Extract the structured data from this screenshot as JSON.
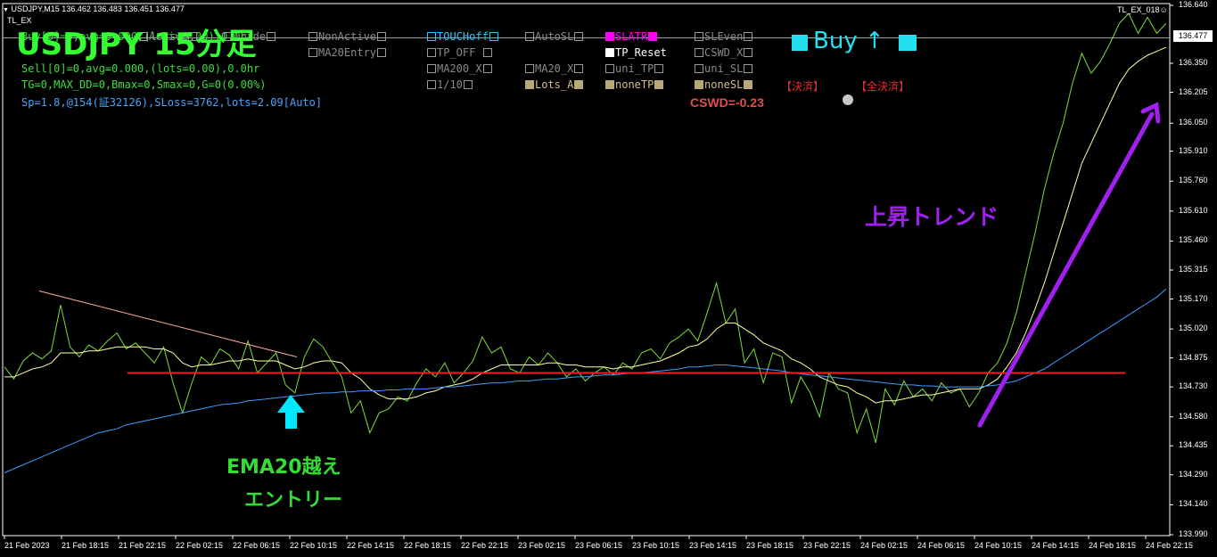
{
  "header": {
    "symbol_line": "USDJPY,M15  136.462 136.483 136.451 136.477",
    "indicator_name": "TL_EX",
    "right_label": "TL_EX_018☺"
  },
  "title_overlay": "USDJPY 15分足",
  "info_lines": [
    "Buy[0]=0,avg=0.000,(lots=0.00),0.0hr",
    "Sell[0]=0,avg=0.000,(lots=0.00),0.0hr",
    "TG=0,MAX_DD=0,Bmax=0,Smax=0,G=0(0.00%)",
    "Sp=1.8,@154(証32126),SLoss=3762,lots=2.09[Auto]"
  ],
  "buttons_row1": {
    "a": "Active",
    "b": "Trade",
    "c": "NonActive"
  },
  "buttons": {
    "ma20entry": "MA20Entry",
    "touchoff": "TOUCHoff",
    "tpoff": "TP_OFF",
    "ma200x": "MA200_X",
    "one_ten": "1/10",
    "autosl": "AutoSL",
    "ma20x": "MA20_X",
    "lots_a": "Lots_A",
    "slatr": "SLATR",
    "tp_reset": "TP_Reset",
    "uni_tp": "uni_TP",
    "nonetp": "noneTP",
    "sleven": "SLEven",
    "cswd_x": "CSWD_X",
    "uni_sl": "uni_SL",
    "nonesl": "noneSL",
    "kessai": "【決済】",
    "zen_kessai": "【全決済】"
  },
  "cswd": "CSWD=-0.23",
  "buy_label": "Buy ↑",
  "annotations": {
    "entry_line1": "EMA20越え",
    "entry_line2": "エントリー",
    "trend": "上昇トレンド"
  },
  "colors": {
    "price": "#7ddc3a",
    "ema20": "#ffffa0",
    "ema200": "#3f9bff",
    "support": "#ff1a1a",
    "trendline": "#ffb0a0",
    "arrow_trend": "#a020f0",
    "arrow_entry": "#00e8ff"
  },
  "price_axis": {
    "labels": [
      "136.640",
      "136.477",
      "136.350",
      "136.205",
      "136.050",
      "135.910",
      "135.760",
      "135.610",
      "135.460",
      "135.315",
      "135.170",
      "135.020",
      "134.875",
      "134.730",
      "134.580",
      "134.435",
      "134.290",
      "134.140",
      "133.990"
    ],
    "current": "136.477",
    "min": 133.99,
    "max": 136.64
  },
  "time_axis": [
    "21 Feb 2023",
    "21 Feb 18:15",
    "21 Feb 22:15",
    "22 Feb 02:15",
    "22 Feb 06:15",
    "22 Feb 10:15",
    "22 Feb 14:15",
    "22 Feb 18:15",
    "22 Feb 22:15",
    "23 Feb 02:15",
    "23 Feb 06:15",
    "23 Feb 10:15",
    "23 Feb 14:15",
    "23 Feb 18:15",
    "23 Feb 22:15",
    "24 Feb 02:15",
    "24 Feb 06:15",
    "24 Feb 10:15",
    "24 Feb 14:15",
    "24 Feb 18:15",
    "24 Feb 22:15"
  ],
  "chart_data": {
    "type": "line",
    "support_level": 134.8,
    "series": [
      {
        "values": [
          134.83,
          134.77,
          134.86,
          134.9,
          134.87,
          134.91,
          135.14,
          134.93,
          134.88,
          134.94,
          134.91,
          134.96,
          135.0,
          134.92,
          134.95,
          134.9,
          134.85,
          134.93,
          134.75,
          134.6,
          134.75,
          134.88,
          134.84,
          134.92,
          134.89,
          134.82,
          134.96,
          134.8,
          134.85,
          134.9,
          134.74,
          134.7,
          134.88,
          134.97,
          134.93,
          134.85,
          134.78,
          134.6,
          134.66,
          134.5,
          134.6,
          134.62,
          134.68,
          134.66,
          134.75,
          134.82,
          134.78,
          134.85,
          134.75,
          134.8,
          134.86,
          134.98,
          134.9,
          134.93,
          134.82,
          134.8,
          134.88,
          134.84,
          134.9,
          134.85,
          134.78,
          134.82,
          134.76,
          134.8,
          134.83,
          134.79,
          134.85,
          134.82,
          134.9,
          134.92,
          134.87,
          134.95,
          134.98,
          135.02,
          134.96,
          135.1,
          135.25,
          135.05,
          135.12,
          134.85,
          134.92,
          134.75,
          134.9,
          134.88,
          134.65,
          134.78,
          134.7,
          134.58,
          134.8,
          134.72,
          134.7,
          134.5,
          134.62,
          134.45,
          134.72,
          134.64,
          134.76,
          134.68,
          134.72,
          134.66,
          134.75,
          134.7,
          134.72,
          134.63,
          134.7,
          134.8,
          134.85,
          134.95,
          135.1,
          135.3,
          135.5,
          135.72,
          135.9,
          136.05,
          136.25,
          136.4,
          136.3,
          136.36,
          136.45,
          136.55,
          136.6,
          136.5,
          136.58,
          136.5,
          136.55
        ]
      },
      {
        "values": [
          134.78,
          134.78,
          134.8,
          134.82,
          134.83,
          134.85,
          134.9,
          134.9,
          134.9,
          134.91,
          134.91,
          134.92,
          134.93,
          134.93,
          134.93,
          134.93,
          134.92,
          134.92,
          134.9,
          134.85,
          134.83,
          134.84,
          134.84,
          134.85,
          134.86,
          134.86,
          134.87,
          134.86,
          134.86,
          134.86,
          134.84,
          134.82,
          134.83,
          134.85,
          134.86,
          134.86,
          134.85,
          134.8,
          134.77,
          134.72,
          134.69,
          134.67,
          134.67,
          134.67,
          134.68,
          134.7,
          134.71,
          134.73,
          134.74,
          134.75,
          134.77,
          134.8,
          134.82,
          134.84,
          134.84,
          134.84,
          134.84,
          134.84,
          134.85,
          134.85,
          134.84,
          134.84,
          134.83,
          134.83,
          134.83,
          134.82,
          134.83,
          134.83,
          134.84,
          134.85,
          134.86,
          134.88,
          134.9,
          134.93,
          134.94,
          134.97,
          135.02,
          135.05,
          135.05,
          135.02,
          134.99,
          134.95,
          134.93,
          134.91,
          134.87,
          134.85,
          134.82,
          134.78,
          134.76,
          134.74,
          134.73,
          134.7,
          134.68,
          134.65,
          134.66,
          134.66,
          134.67,
          134.68,
          134.69,
          134.69,
          134.7,
          134.71,
          134.72,
          134.72,
          134.72,
          134.74,
          134.77,
          134.83,
          134.9,
          135.0,
          135.12,
          135.25,
          135.4,
          135.55,
          135.7,
          135.85,
          135.95,
          136.05,
          136.15,
          136.25,
          136.32,
          136.36,
          136.39,
          136.41,
          136.43
        ]
      },
      {
        "values": [
          134.3,
          134.32,
          134.34,
          134.36,
          134.38,
          134.4,
          134.42,
          134.44,
          134.46,
          134.48,
          134.5,
          134.51,
          134.52,
          134.54,
          134.55,
          134.56,
          134.57,
          134.58,
          134.59,
          134.6,
          134.61,
          134.62,
          134.63,
          134.64,
          134.645,
          134.65,
          134.66,
          134.665,
          134.67,
          134.675,
          134.68,
          134.685,
          134.69,
          134.695,
          134.7,
          134.7,
          134.705,
          134.705,
          134.71,
          134.71,
          134.71,
          134.715,
          134.715,
          134.72,
          134.72,
          134.72,
          134.725,
          134.73,
          134.73,
          134.735,
          134.74,
          134.745,
          134.75,
          134.75,
          134.755,
          134.76,
          134.76,
          134.765,
          134.77,
          134.77,
          134.775,
          134.78,
          134.78,
          134.785,
          134.79,
          134.79,
          134.795,
          134.8,
          134.8,
          134.805,
          134.81,
          134.815,
          134.82,
          134.83,
          134.83,
          134.835,
          134.84,
          134.84,
          134.835,
          134.83,
          134.825,
          134.82,
          134.815,
          134.81,
          134.8,
          134.795,
          134.79,
          134.785,
          134.78,
          134.775,
          134.77,
          134.765,
          134.76,
          134.755,
          134.75,
          134.745,
          134.74,
          134.74,
          134.735,
          134.735,
          134.73,
          134.73,
          134.73,
          134.73,
          134.73,
          134.735,
          134.74,
          134.75,
          134.76,
          134.78,
          134.8,
          134.82,
          134.85,
          134.88,
          134.91,
          134.94,
          134.97,
          135.0,
          135.03,
          135.06,
          135.09,
          135.12,
          135.15,
          135.18,
          135.22
        ]
      }
    ]
  }
}
